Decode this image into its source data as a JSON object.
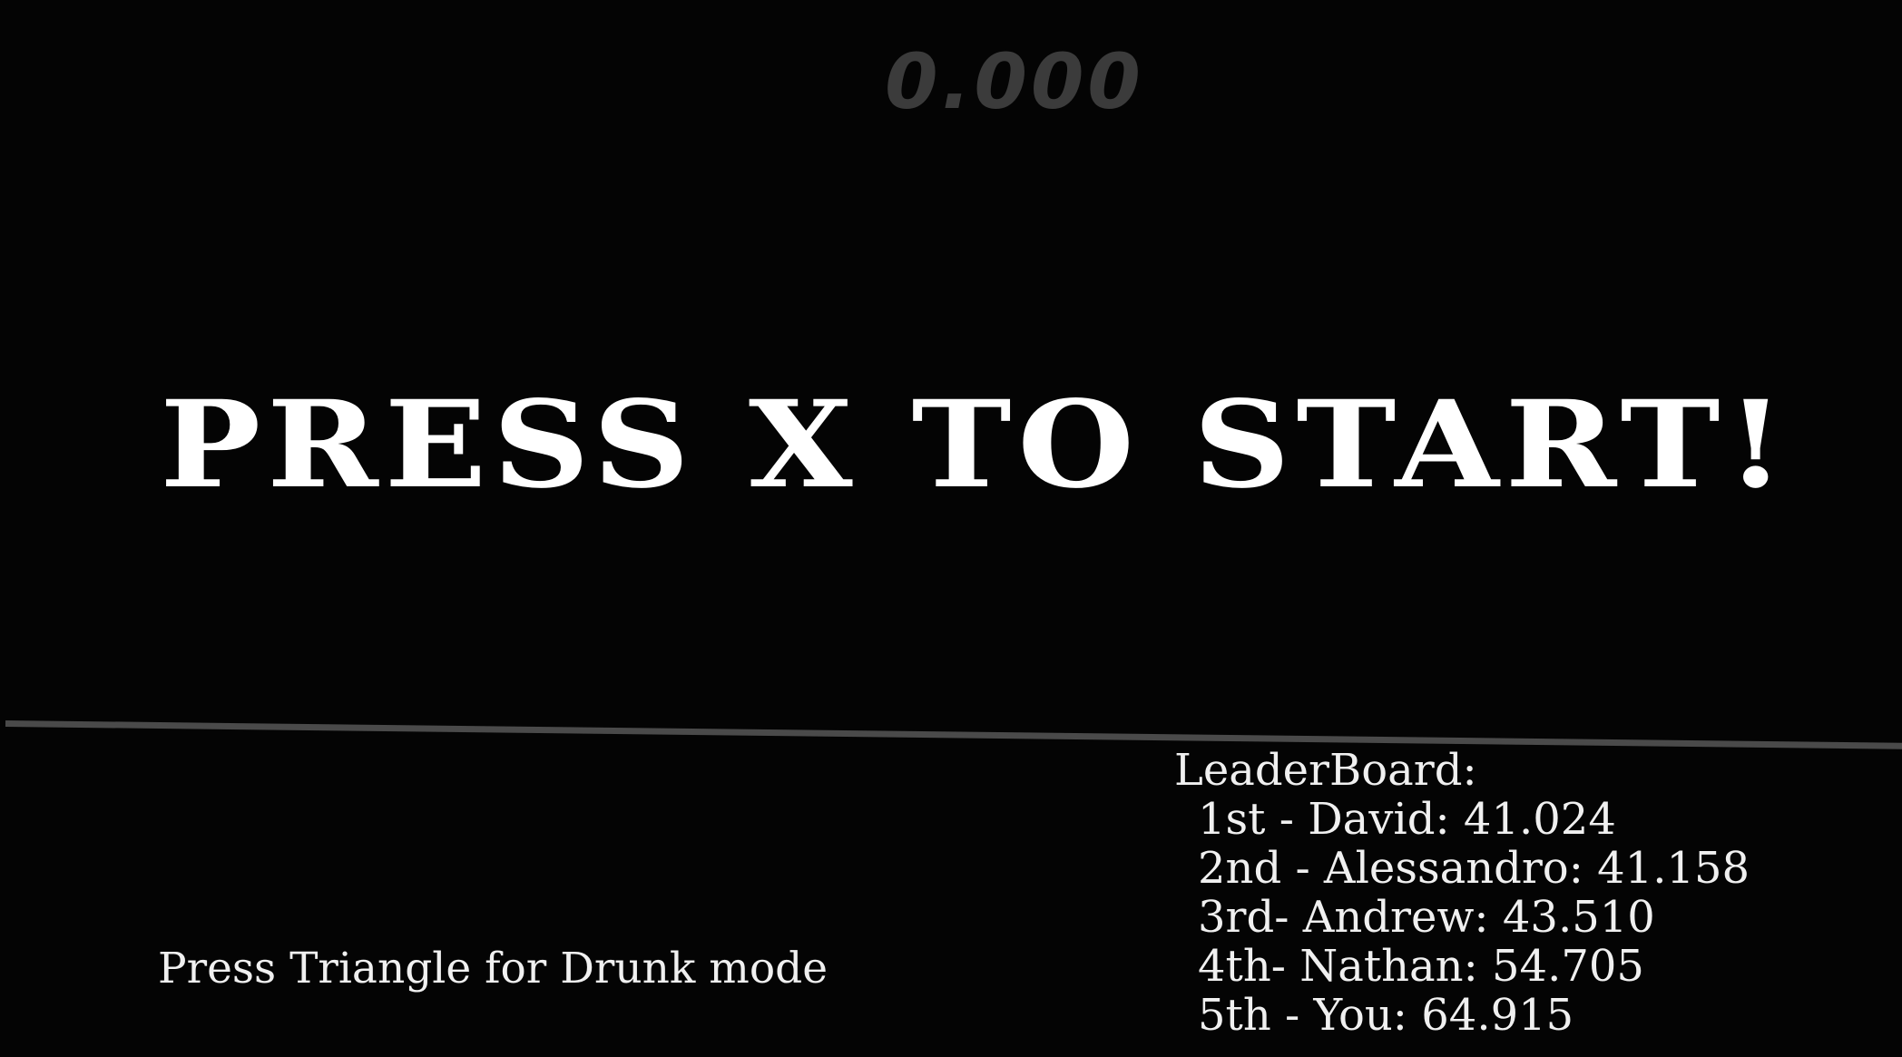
{
  "hud": {
    "timer": "0.000"
  },
  "prompt": {
    "start": "PRESS X TO START!",
    "drunk_mode": "Press Triangle for Drunk mode"
  },
  "leaderboard": {
    "title": "LeaderBoard:",
    "entries": [
      "1st - David: 41.024",
      "2nd - Alessandro: 41.158",
      "3rd- Andrew: 43.510",
      "4th- Nathan: 54.705",
      "5th - You: 64.915"
    ]
  },
  "colors": {
    "background": "#040404",
    "timer": "#3b3b3b",
    "text": "#ffffff",
    "floor_line": "#4a4a4a"
  }
}
